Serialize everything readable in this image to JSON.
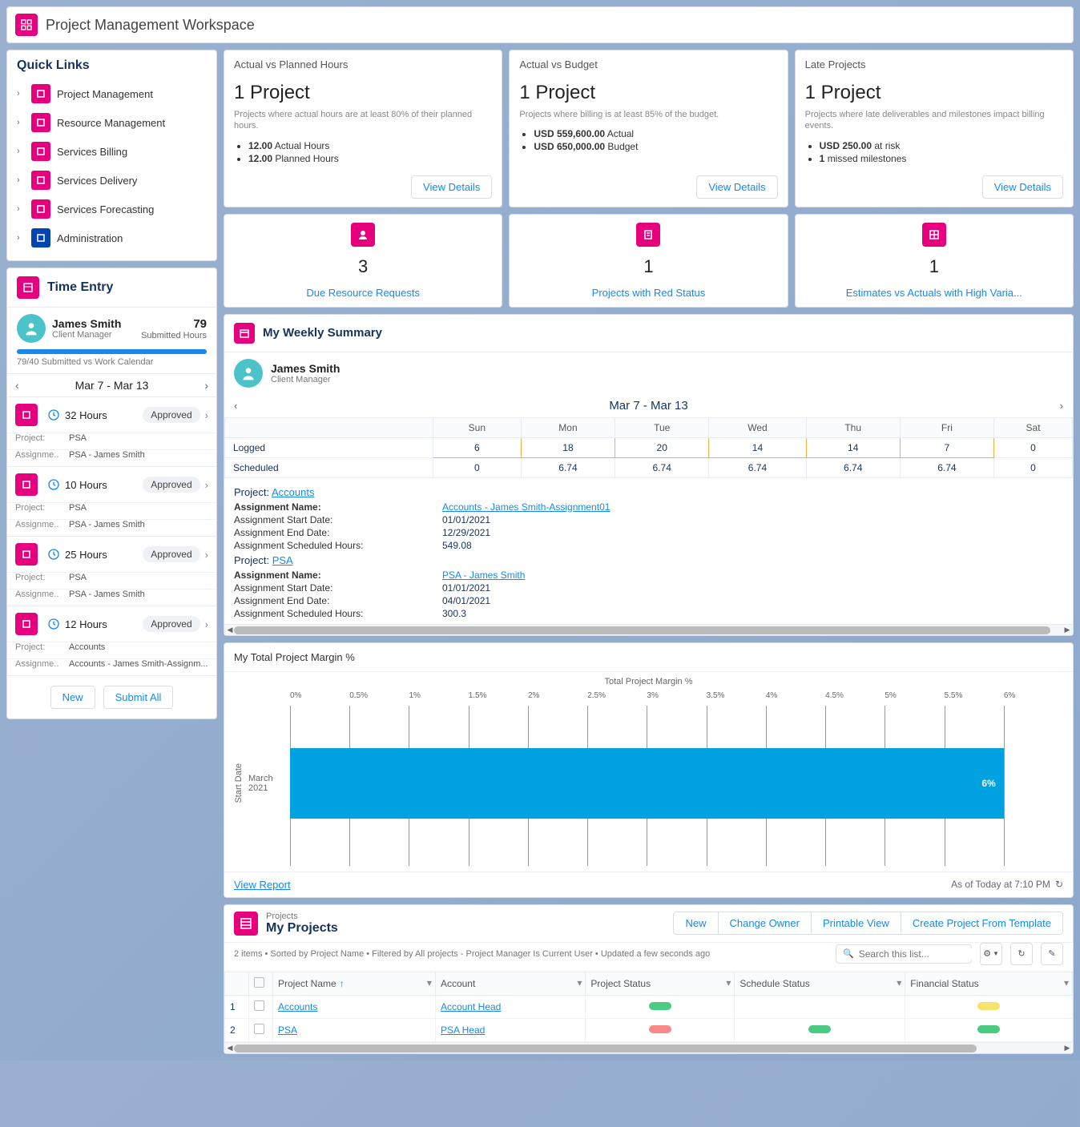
{
  "header": {
    "title": "Project Management Workspace"
  },
  "quick_links": {
    "heading": "Quick Links",
    "items": [
      "Project Management",
      "Resource Management",
      "Services Billing",
      "Services Delivery",
      "Services Forecasting",
      "Administration"
    ]
  },
  "time_entry": {
    "heading": "Time Entry",
    "user_name": "James Smith",
    "user_role": "Client Manager",
    "submitted_num": "79",
    "submitted_label": "Submitted Hours",
    "caption": "79/40 Submitted vs Work Calendar",
    "week_label": "Mar 7 - Mar 13",
    "rows": [
      {
        "hours": "32 Hours",
        "status": "Approved",
        "project": "PSA",
        "assignment": "PSA - James Smith"
      },
      {
        "hours": "10 Hours",
        "status": "Approved",
        "project": "PSA",
        "assignment": "PSA - James Smith"
      },
      {
        "hours": "25 Hours",
        "status": "Approved",
        "project": "PSA",
        "assignment": "PSA - James Smith"
      },
      {
        "hours": "12 Hours",
        "status": "Approved",
        "project": "Accounts",
        "assignment": "Accounts - James Smith-Assignm..."
      }
    ],
    "label_project": "Project:",
    "label_assign": "Assignme...",
    "btn_new": "New",
    "btn_submit": "Submit All"
  },
  "kpis": {
    "actual_vs_planned": {
      "title": "Actual vs Planned Hours",
      "headline": "1 Project",
      "desc": "Projects where actual hours are at least 80% of their planned hours.",
      "bullet1_b": "12.00",
      "bullet1": "Actual Hours",
      "bullet2_b": "12.00",
      "bullet2": "Planned Hours",
      "view": "View Details"
    },
    "actual_vs_budget": {
      "title": "Actual vs Budget",
      "headline": "1 Project",
      "desc": "Projects where billing is at least 85% of the budget.",
      "bullet1_b": "USD 559,600.00",
      "bullet1": "Actual",
      "bullet2_b": "USD 650,000.00",
      "bullet2": "Budget",
      "view": "View Details"
    },
    "late": {
      "title": "Late Projects",
      "headline": "1 Project",
      "desc": "Projects where late deliverables and milestones impact billing events.",
      "bullet1_b": "USD 250.00",
      "bullet1": "at risk",
      "bullet2_b": "1",
      "bullet2": "missed milestones",
      "view": "View Details"
    }
  },
  "tiles": {
    "t1_num": "3",
    "t1_label": "Due Resource Requests",
    "t2_num": "1",
    "t2_label": "Projects with Red Status",
    "t3_num": "1",
    "t3_label": "Estimates vs Actuals with High Varia..."
  },
  "weekly": {
    "title": "My Weekly Summary",
    "user_name": "James Smith",
    "user_role": "Client Manager",
    "week_label": "Mar 7 - Mar 13",
    "days": [
      "Sun",
      "Mon",
      "Tue",
      "Wed",
      "Thu",
      "Fri",
      "Sat"
    ],
    "row_logged_label": "Logged",
    "row_sched_label": "Scheduled",
    "logged": [
      "6",
      "18",
      "20",
      "14",
      "14",
      "7",
      "0"
    ],
    "scheduled": [
      "0",
      "6.74",
      "6.74",
      "6.74",
      "6.74",
      "6.74",
      "0"
    ],
    "project_label": "Project:",
    "proj1": "Accounts",
    "assign_name_label": "Assignment Name:",
    "assign_start_label": "Assignment Start Date:",
    "assign_end_label": "Assignment End Date:",
    "assign_sched_label": "Assignment Scheduled Hours:",
    "a1_name": "Accounts - James Smith-Assignment01",
    "a1_start": "01/01/2021",
    "a1_end": "12/29/2021",
    "a1_hours": "549.08",
    "proj2": "PSA",
    "a2_name": "PSA - James Smith",
    "a2_start": "01/01/2021",
    "a2_end": "04/01/2021",
    "a2_hours": "300.3"
  },
  "chart": {
    "title": "My Total Project Margin %",
    "top_label": "Total Project Margin %",
    "y_label": "Start Date",
    "y_cat": "March 2021",
    "bar_label": "6%",
    "view_report": "View Report",
    "as_of": "As of Today at 7:10 PM"
  },
  "chart_data": {
    "type": "bar",
    "orientation": "horizontal",
    "title": "My Total Project Margin %",
    "xlabel": "Total Project Margin %",
    "ylabel": "Start Date",
    "xlim": [
      0,
      6.5
    ],
    "x_ticks": [
      0,
      0.5,
      1,
      1.5,
      2,
      2.5,
      3,
      3.5,
      4,
      4.5,
      5,
      5.5,
      6
    ],
    "categories": [
      "March 2021"
    ],
    "values": [
      6
    ]
  },
  "projects": {
    "super": "Projects",
    "title": "My Projects",
    "btns": {
      "new": "New",
      "owner": "Change Owner",
      "print": "Printable View",
      "template": "Create Project From Template"
    },
    "sub": "2 items • Sorted by Project Name • Filtered by All projects - Project Manager Is Current User • Updated a few seconds ago",
    "search_placeholder": "Search this list...",
    "cols": {
      "name": "Project Name",
      "account": "Account",
      "pstatus": "Project Status",
      "sstatus": "Schedule Status",
      "fstatus": "Financial Status"
    },
    "rows": [
      {
        "n": "1",
        "name": "Accounts",
        "account": "Account Head",
        "p": "green",
        "s": "",
        "f": "yellow"
      },
      {
        "n": "2",
        "name": "PSA",
        "account": "PSA Head",
        "p": "red",
        "s": "green",
        "f": "green"
      }
    ]
  }
}
